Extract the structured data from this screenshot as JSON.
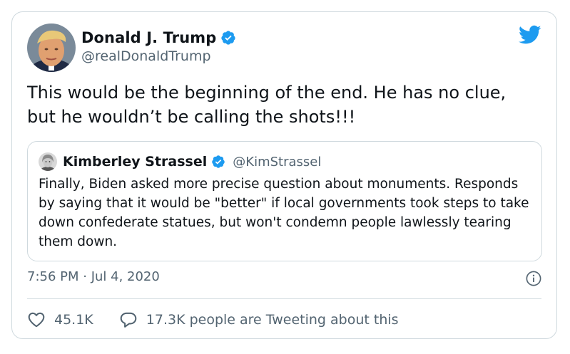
{
  "colors": {
    "brand_blue": "#1d9bf0",
    "text_primary": "#0f1419",
    "text_secondary": "#536471",
    "border": "#cfd9de"
  },
  "tweet": {
    "author": {
      "name": "Donald J. Trump",
      "handle": "@realDonaldTrump",
      "verified": true,
      "avatar_icon": "avatar-photo",
      "verified_icon": "verified-badge-icon"
    },
    "brand_icon": "twitter-bird-icon",
    "text": "This would be the beginning of the end. He has no clue, but he wouldn’t be calling the shots!!!",
    "quoted": {
      "name": "Kimberley Strassel",
      "handle": "@KimStrassel",
      "verified": true,
      "avatar_icon": "avatar-photo",
      "text": "Finally, Biden asked more precise question about monuments. Responds by saying that it would be \"better\" if local governments took steps to take down confederate statues, but won't condemn people lawlessly tearing them down."
    },
    "timestamp": "7:56 PM · Jul 4, 2020",
    "info_icon": "info-icon",
    "actions": {
      "likes": "45.1K",
      "like_icon": "heart-icon",
      "conversation": "17.3K people are Tweeting about this",
      "conversation_icon": "reply-bubble-icon"
    }
  }
}
